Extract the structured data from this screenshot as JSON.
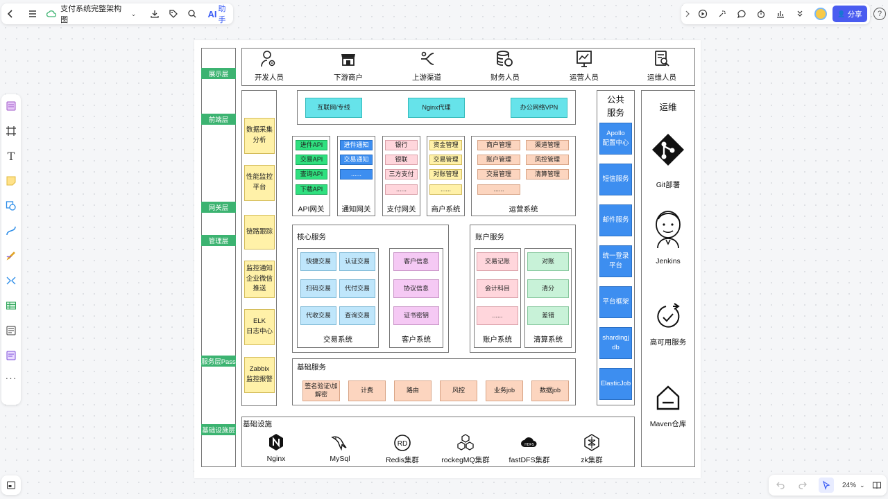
{
  "topbar": {
    "doc_title": "支付系统完整架构图",
    "ai_label": "AI",
    "ai_suffix": "助手",
    "share_label": "分享"
  },
  "zoom": {
    "level": "24%"
  },
  "diagram": {
    "layers": [
      "展示层",
      "前端层",
      "网关层",
      "管理层",
      "服务层Pass",
      "基础设施层"
    ],
    "users": [
      "开发人员",
      "下游商户",
      "上游渠道",
      "财务人员",
      "运营人员",
      "运维人员"
    ],
    "frontend": [
      "互联网/专线",
      "Nginx代理",
      "办公网络VPN"
    ],
    "monitor": [
      "数据采集\n分析",
      "性能监控\n平台",
      "链路跟踪",
      "监控通知\n企业微信\n推送",
      "ELK\n日志中心",
      "Zabbix\n监控报警"
    ],
    "api_gateway": {
      "items": [
        "进件API",
        "交易API",
        "查询API",
        "下载API"
      ],
      "label": "API网关"
    },
    "notify_gateway": {
      "items": [
        "进件通知",
        "交易通知",
        "......"
      ],
      "label": "通知网关"
    },
    "pay_gateway": {
      "items": [
        "银行",
        "银联",
        "三方支付",
        "......"
      ],
      "label": "支付网关"
    },
    "merchant_system": {
      "items": [
        "资金管理",
        "交易管理",
        "对账管理",
        "......"
      ],
      "label": "商户系统"
    },
    "ops_system": {
      "items": [
        "商户管理",
        "渠道管理",
        "账户管理",
        "风控管理",
        "交易管理",
        "清算管理",
        "......"
      ],
      "label": "运营系统"
    },
    "core_service": {
      "title": "核心服务",
      "trade": {
        "items": [
          "快捷交易",
          "认证交易",
          "扫码交易",
          "代付交易",
          "代收交易",
          "查询交易"
        ],
        "label": "交易系统"
      },
      "customer": {
        "items": [
          "客户信息",
          "协议信息",
          "证书密钥"
        ],
        "label": "客户系统"
      }
    },
    "account_service": {
      "title": "账户服务",
      "account": {
        "items": [
          "交易记账",
          "会计科目",
          "......"
        ],
        "label": "账户系统"
      },
      "clearing": {
        "items": [
          "对账",
          "清分",
          "差错"
        ],
        "label": "清算系统"
      }
    },
    "base_service": {
      "title": "基础服务",
      "items": [
        "签名验证\\加\n解密",
        "计费",
        "路由",
        "风控",
        "业务job",
        "数据job"
      ]
    },
    "infrastructure": {
      "title": "基础设施",
      "items": [
        "Nginx",
        "MySql",
        "Redis集群",
        "rockegMQ集群",
        "fastDFS集群",
        "zk集群"
      ]
    },
    "public_service": {
      "title": "公共\n服务",
      "items": [
        "Apollo\n配置中心",
        "短信服务",
        "邮件服务",
        "统一登录\n平台",
        "平台框架",
        "shardingj\ndb",
        "ElasticJob"
      ]
    },
    "ops": {
      "title": "运维",
      "items": [
        "Git部署",
        "Jenkins",
        "高可用服务",
        "Maven仓库"
      ]
    }
  }
}
